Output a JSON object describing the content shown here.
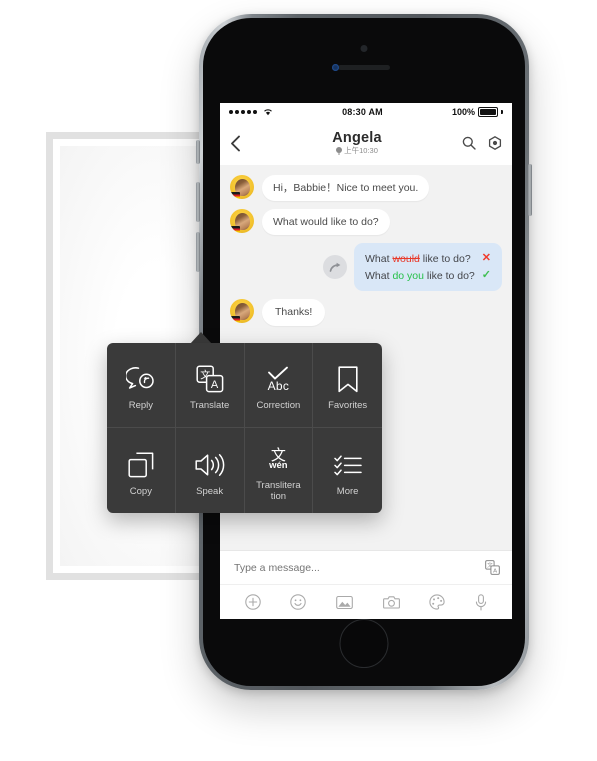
{
  "status_bar": {
    "signal_dots": 5,
    "wifi_icon": "wifi-icon",
    "time": "08:30 AM",
    "battery_percent": "100%"
  },
  "nav_bar": {
    "back_icon": "chevron-left-icon",
    "contact_name": "Angela",
    "contact_status": "上午10:30",
    "location_icon": "location-pin-icon",
    "search_icon": "search-icon",
    "more_icon": "target-icon"
  },
  "chat": {
    "messages": [
      {
        "id": "msg-1",
        "side": "left",
        "text": "Hi，Babbie！Nice to meet you.",
        "avatar": "contact-avatar"
      },
      {
        "id": "msg-2",
        "side": "left",
        "text": "What would like to do?",
        "avatar": "contact-avatar"
      },
      {
        "id": "msg-4",
        "side": "left",
        "text": "Thanks!",
        "avatar": "contact-avatar"
      }
    ],
    "correction": {
      "icon": "forward-arrow-icon",
      "wrong": {
        "prefix": "What ",
        "error": "would",
        "suffix": " like to do?",
        "mark": "✕"
      },
      "right": {
        "prefix": "What ",
        "fix": "do you",
        "suffix": " like to do?",
        "mark": "✓"
      }
    }
  },
  "action_menu": {
    "items": [
      {
        "label": "Reply",
        "icon": "reply-bubble-icon"
      },
      {
        "label": "Translate",
        "icon": "translate-icon"
      },
      {
        "label": "Correction",
        "icon": "correction-abc-icon",
        "glyph": "Abc"
      },
      {
        "label": "Favorites",
        "icon": "bookmark-icon"
      },
      {
        "label": "Copy",
        "icon": "copy-icon"
      },
      {
        "label": "Speak",
        "icon": "speaker-icon"
      },
      {
        "label": "Translitera\ntion",
        "icon": "transliteration-icon",
        "glyph_cjk": "文",
        "glyph_pinyin": "wén"
      },
      {
        "label": "More",
        "icon": "checklist-icon"
      }
    ]
  },
  "input_bar": {
    "placeholder": "Type a message...",
    "translate_icon": "translate-icon",
    "tools": [
      {
        "name": "plus-icon"
      },
      {
        "name": "smiley-icon"
      },
      {
        "name": "image-icon"
      },
      {
        "name": "camera-icon"
      },
      {
        "name": "palette-icon"
      },
      {
        "name": "microphone-icon"
      }
    ]
  },
  "colors": {
    "menu_bg": "#3a3a3a",
    "correction_bubble": "#d9e7f7",
    "error_red": "#e8392a",
    "fix_green": "#27c04a",
    "chat_bg": "#f2f2f2"
  }
}
